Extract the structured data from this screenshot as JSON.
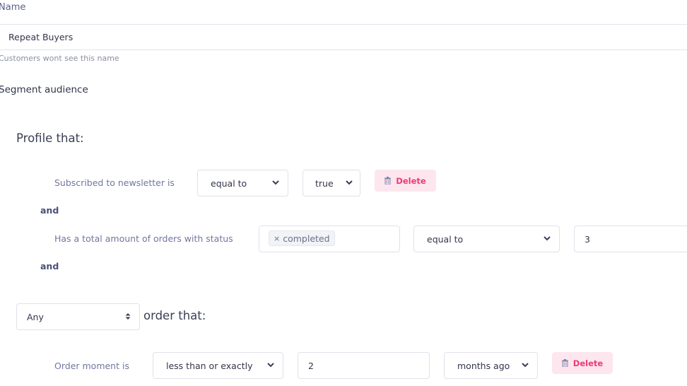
{
  "name_field": {
    "label": "Name",
    "value": "Repeat Buyers",
    "hint": "Customers wont see this name"
  },
  "segment": {
    "title": "Segment audience",
    "profile_heading": "Profile that:",
    "conditions": [
      {
        "label": "Subscribed to newsletter is",
        "operator": "equal to",
        "value": "true",
        "delete_label": "Delete"
      },
      {
        "connector": "and"
      },
      {
        "label": "Has a total amount of orders with status",
        "status_tags": [
          "completed"
        ],
        "tag_remove_glyph": "×",
        "operator": "equal to",
        "value": "3"
      },
      {
        "connector": "and"
      }
    ],
    "order_group": {
      "quantifier": "Any",
      "heading": "order that:",
      "conditions": [
        {
          "label": "Order moment is",
          "operator": "less than or exactly",
          "value": "2",
          "unit": "months ago",
          "delete_label": "Delete"
        }
      ]
    }
  },
  "icons": {
    "chevron_down": "❯",
    "sort_arrows_up": "▲",
    "sort_arrows_down": "▼",
    "trash": "trash-icon"
  },
  "colors": {
    "delete_bg": "#fde6ee",
    "delete_text": "#ee3b73",
    "label_muted": "#7176a0",
    "connector": "#4b5178"
  }
}
